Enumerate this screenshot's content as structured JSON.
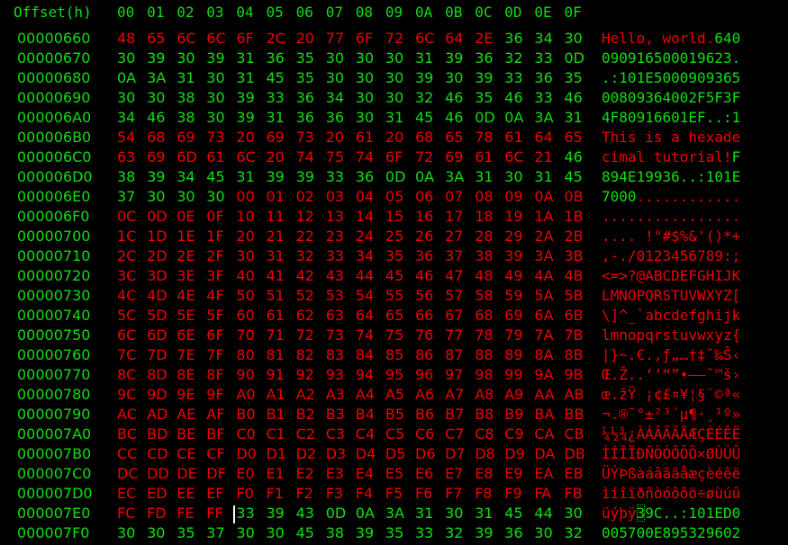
{
  "app": {
    "header": {
      "offset_label": "Offset(h)",
      "columns": [
        "00",
        "01",
        "02",
        "03",
        "04",
        "05",
        "06",
        "07",
        "08",
        "09",
        "0A",
        "0B",
        "0C",
        "0D",
        "0E",
        "0F"
      ]
    },
    "colors": {
      "default": "#11dd11",
      "highlight": "#ee0000",
      "cursor": "#ffffff"
    },
    "cursor": {
      "row_offset": "000007E0",
      "byte_index": 4
    },
    "rows": [
      {
        "offset": "00000660",
        "bytes": [
          "48",
          "65",
          "6C",
          "6C",
          "6F",
          "2C",
          "20",
          "77",
          "6F",
          "72",
          "6C",
          "64",
          "2E",
          "36",
          "34",
          "30"
        ],
        "ascii": "Hello, world.640",
        "red": [
          0,
          1,
          2,
          3,
          4,
          5,
          6,
          7,
          8,
          9,
          10,
          11,
          12
        ]
      },
      {
        "offset": "00000670",
        "bytes": [
          "30",
          "39",
          "30",
          "39",
          "31",
          "36",
          "35",
          "30",
          "30",
          "30",
          "31",
          "39",
          "36",
          "32",
          "33",
          "0D"
        ],
        "ascii": "090916500019623.",
        "red": []
      },
      {
        "offset": "00000680",
        "bytes": [
          "0A",
          "3A",
          "31",
          "30",
          "31",
          "45",
          "35",
          "30",
          "30",
          "30",
          "39",
          "30",
          "39",
          "33",
          "36",
          "35"
        ],
        "ascii": ".:101E5000909365",
        "red": []
      },
      {
        "offset": "00000690",
        "bytes": [
          "30",
          "30",
          "38",
          "30",
          "39",
          "33",
          "36",
          "34",
          "30",
          "30",
          "32",
          "46",
          "35",
          "46",
          "33",
          "46"
        ],
        "ascii": "00809364002F5F3F",
        "red": []
      },
      {
        "offset": "000006A0",
        "bytes": [
          "34",
          "46",
          "38",
          "30",
          "39",
          "31",
          "36",
          "36",
          "30",
          "31",
          "45",
          "46",
          "0D",
          "0A",
          "3A",
          "31"
        ],
        "ascii": "4F80916601EF..:1",
        "red": []
      },
      {
        "offset": "000006B0",
        "bytes": [
          "54",
          "68",
          "69",
          "73",
          "20",
          "69",
          "73",
          "20",
          "61",
          "20",
          "68",
          "65",
          "78",
          "61",
          "64",
          "65"
        ],
        "ascii": "This is a hexade",
        "red": [
          0,
          1,
          2,
          3,
          4,
          5,
          6,
          7,
          8,
          9,
          10,
          11,
          12,
          13,
          14,
          15
        ]
      },
      {
        "offset": "000006C0",
        "bytes": [
          "63",
          "69",
          "6D",
          "61",
          "6C",
          "20",
          "74",
          "75",
          "74",
          "6F",
          "72",
          "69",
          "61",
          "6C",
          "21",
          "46"
        ],
        "ascii": "cimal tutorial!F",
        "red": [
          0,
          1,
          2,
          3,
          4,
          5,
          6,
          7,
          8,
          9,
          10,
          11,
          12,
          13,
          14
        ]
      },
      {
        "offset": "000006D0",
        "bytes": [
          "38",
          "39",
          "34",
          "45",
          "31",
          "39",
          "39",
          "33",
          "36",
          "0D",
          "0A",
          "3A",
          "31",
          "30",
          "31",
          "45"
        ],
        "ascii": "894E19936..:101E",
        "red": []
      },
      {
        "offset": "000006E0",
        "bytes": [
          "37",
          "30",
          "30",
          "30",
          "00",
          "01",
          "02",
          "03",
          "04",
          "05",
          "06",
          "07",
          "08",
          "09",
          "0A",
          "0B"
        ],
        "ascii": "7000............",
        "red": [
          4,
          5,
          6,
          7,
          8,
          9,
          10,
          11,
          12,
          13,
          14,
          15
        ]
      },
      {
        "offset": "000006F0",
        "bytes": [
          "0C",
          "0D",
          "0E",
          "0F",
          "10",
          "11",
          "12",
          "13",
          "14",
          "15",
          "16",
          "17",
          "18",
          "19",
          "1A",
          "1B"
        ],
        "ascii": "................",
        "red": "all"
      },
      {
        "offset": "00000700",
        "bytes": [
          "1C",
          "1D",
          "1E",
          "1F",
          "20",
          "21",
          "22",
          "23",
          "24",
          "25",
          "26",
          "27",
          "28",
          "29",
          "2A",
          "2B"
        ],
        "ascii": ".... !\"#$%&'()*+",
        "red": "all"
      },
      {
        "offset": "00000710",
        "bytes": [
          "2C",
          "2D",
          "2E",
          "2F",
          "30",
          "31",
          "32",
          "33",
          "34",
          "35",
          "36",
          "37",
          "38",
          "39",
          "3A",
          "3B"
        ],
        "ascii": ",-./0123456789:;",
        "red": "all"
      },
      {
        "offset": "00000720",
        "bytes": [
          "3C",
          "3D",
          "3E",
          "3F",
          "40",
          "41",
          "42",
          "43",
          "44",
          "45",
          "46",
          "47",
          "48",
          "49",
          "4A",
          "4B"
        ],
        "ascii": "<=>?@ABCDEFGHIJK",
        "red": "all"
      },
      {
        "offset": "00000730",
        "bytes": [
          "4C",
          "4D",
          "4E",
          "4F",
          "50",
          "51",
          "52",
          "53",
          "54",
          "55",
          "56",
          "57",
          "58",
          "59",
          "5A",
          "5B"
        ],
        "ascii": "LMNOPQRSTUVWXYZ[",
        "red": "all"
      },
      {
        "offset": "00000740",
        "bytes": [
          "5C",
          "5D",
          "5E",
          "5F",
          "60",
          "61",
          "62",
          "63",
          "64",
          "65",
          "66",
          "67",
          "68",
          "69",
          "6A",
          "6B"
        ],
        "ascii": "\\]^_`abcdefghijk",
        "red": "all"
      },
      {
        "offset": "00000750",
        "bytes": [
          "6C",
          "6D",
          "6E",
          "6F",
          "70",
          "71",
          "72",
          "73",
          "74",
          "75",
          "76",
          "77",
          "78",
          "79",
          "7A",
          "7B"
        ],
        "ascii": "lmnopqrstuvwxyz{",
        "red": "all"
      },
      {
        "offset": "00000760",
        "bytes": [
          "7C",
          "7D",
          "7E",
          "7F",
          "80",
          "81",
          "82",
          "83",
          "84",
          "85",
          "86",
          "87",
          "88",
          "89",
          "8A",
          "8B"
        ],
        "ascii": "|}~.€.‚ƒ„…†‡ˆ‰Š‹",
        "red": "all"
      },
      {
        "offset": "00000770",
        "bytes": [
          "8C",
          "8D",
          "8E",
          "8F",
          "90",
          "91",
          "92",
          "93",
          "94",
          "95",
          "96",
          "97",
          "98",
          "99",
          "9A",
          "9B"
        ],
        "ascii": "Œ.Ž..‘’“”•–—˜™š›",
        "red": "all"
      },
      {
        "offset": "00000780",
        "bytes": [
          "9C",
          "9D",
          "9E",
          "9F",
          "A0",
          "A1",
          "A2",
          "A3",
          "A4",
          "A5",
          "A6",
          "A7",
          "A8",
          "A9",
          "AA",
          "AB"
        ],
        "ascii": "œ.žŸ ¡¢£¤¥¦§¨©ª«",
        "red": "all"
      },
      {
        "offset": "00000790",
        "bytes": [
          "AC",
          "AD",
          "AE",
          "AF",
          "B0",
          "B1",
          "B2",
          "B3",
          "B4",
          "B5",
          "B6",
          "B7",
          "B8",
          "B9",
          "BA",
          "BB"
        ],
        "ascii": "¬.®¯°±²³´µ¶·¸¹º»",
        "red": "all"
      },
      {
        "offset": "000007A0",
        "bytes": [
          "BC",
          "BD",
          "BE",
          "BF",
          "C0",
          "C1",
          "C2",
          "C3",
          "C4",
          "C5",
          "C6",
          "C7",
          "C8",
          "C9",
          "CA",
          "CB"
        ],
        "ascii": "¼½¾¿ÀÁÂÃÄÅÆÇÈÉÊË",
        "red": "all"
      },
      {
        "offset": "000007B0",
        "bytes": [
          "CC",
          "CD",
          "CE",
          "CF",
          "D0",
          "D1",
          "D2",
          "D3",
          "D4",
          "D5",
          "D6",
          "D7",
          "D8",
          "D9",
          "DA",
          "DB"
        ],
        "ascii": "ÌÍÎÏÐÑÒÓÔÕÖ×ØÙÚÛ",
        "red": "all"
      },
      {
        "offset": "000007C0",
        "bytes": [
          "DC",
          "DD",
          "DE",
          "DF",
          "E0",
          "E1",
          "E2",
          "E3",
          "E4",
          "E5",
          "E6",
          "E7",
          "E8",
          "E9",
          "EA",
          "EB"
        ],
        "ascii": "ÜÝÞßàáâãäåæçèéêë",
        "red": "all"
      },
      {
        "offset": "000007D0",
        "bytes": [
          "EC",
          "ED",
          "EE",
          "EF",
          "F0",
          "F1",
          "F2",
          "F3",
          "F4",
          "F5",
          "F6",
          "F7",
          "F8",
          "F9",
          "FA",
          "FB"
        ],
        "ascii": "ìíîïðñòóôõö÷øùúû",
        "red": "all"
      },
      {
        "offset": "000007E0",
        "bytes": [
          "FC",
          "FD",
          "FE",
          "FF",
          "33",
          "39",
          "43",
          "0D",
          "0A",
          "3A",
          "31",
          "30",
          "31",
          "45",
          "44",
          "30"
        ],
        "ascii": "üýþÿ39C..:101ED0",
        "red": [
          0,
          1,
          2,
          3
        ]
      },
      {
        "offset": "000007F0",
        "bytes": [
          "30",
          "30",
          "35",
          "37",
          "30",
          "30",
          "45",
          "38",
          "39",
          "35",
          "33",
          "32",
          "39",
          "36",
          "30",
          "32"
        ],
        "ascii": "005700E895329602",
        "red": []
      }
    ]
  }
}
